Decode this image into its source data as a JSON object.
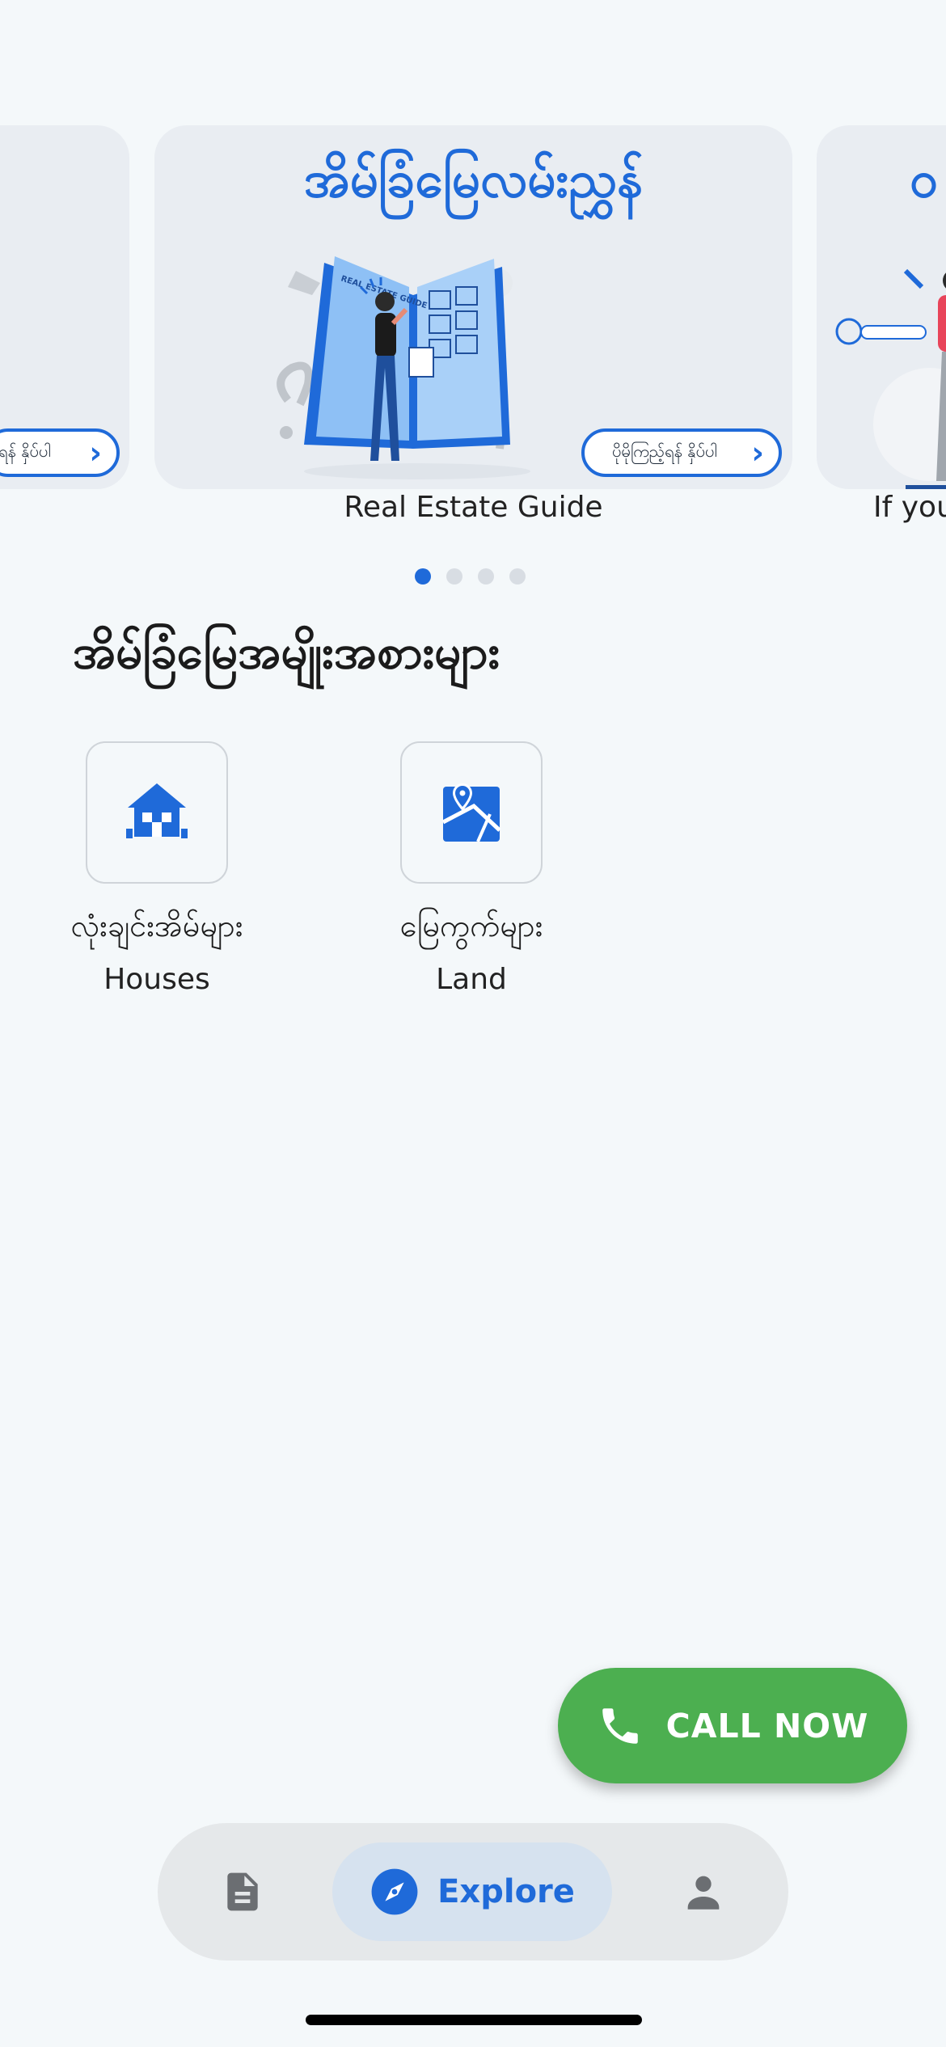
{
  "carousel": {
    "cards": [
      {
        "title": "",
        "button_label": "ရန် နှိပ်ပါ",
        "caption": ""
      },
      {
        "title": "အိမ်ခြံမြေလမ်းညွှန်",
        "button_label": "ပိုမိုကြည့်ရန် နှိပ်ပါ",
        "caption": "Real Estate Guide",
        "illustration_text": "REAL ESTATE GUIDE"
      },
      {
        "title": "ဝ",
        "button_label": "",
        "caption": "If you"
      }
    ],
    "page_count": 4,
    "active_index": 0
  },
  "categories": {
    "title": "အိမ်ခြံမြေအမျိုးအစားများ",
    "items": [
      {
        "label_my": "လုံးချင်းအိမ်များ",
        "label_en": "Houses",
        "icon": "house-icon"
      },
      {
        "label_my": "မြေကွက်များ",
        "label_en": "Land",
        "icon": "map-pin-icon"
      }
    ]
  },
  "fab": {
    "label": "CALL NOW",
    "icon": "phone-icon",
    "color": "#4caf50"
  },
  "bottom_nav": {
    "items": [
      {
        "icon": "document-icon",
        "label": ""
      },
      {
        "icon": "compass-icon",
        "label": "Explore",
        "active": true
      },
      {
        "icon": "person-icon",
        "label": ""
      }
    ]
  },
  "colors": {
    "accent": "#1f6ad9",
    "background": "#f4f8fa",
    "card": "#e9edf2",
    "nav_bg": "#e5e8ea",
    "nav_active": "#d6e2ef"
  }
}
